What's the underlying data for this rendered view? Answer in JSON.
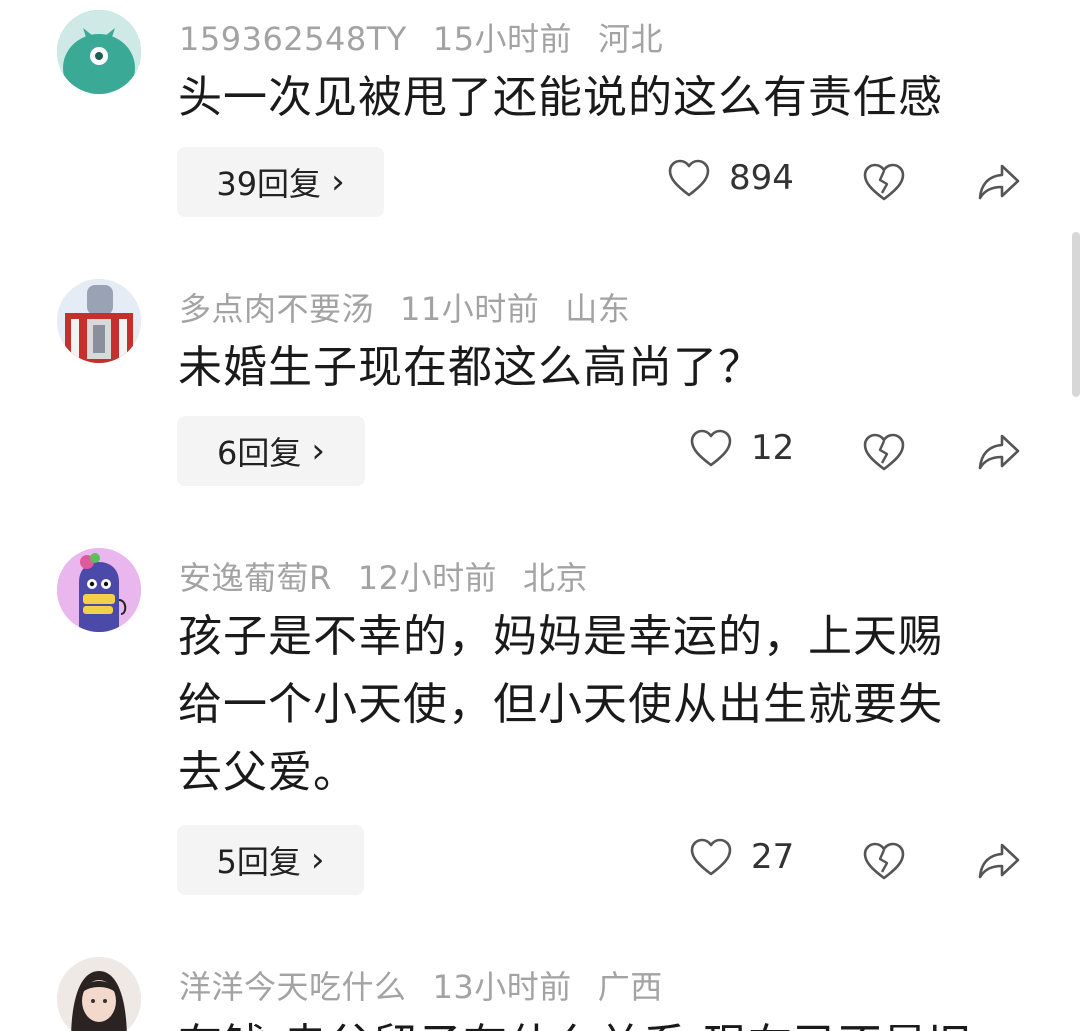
{
  "comments": [
    {
      "username": "159362548TY",
      "time": "15小时前",
      "location": "河北",
      "text_lines": [
        "头一次见被甩了还能说的这么有责任感"
      ],
      "reply_label": "39回复",
      "likes": "894",
      "avatar_icon": "teal-monster-avatar"
    },
    {
      "username": "多点肉不要汤",
      "time": "11小时前",
      "location": "山东",
      "text_lines": [
        "未婚生子现在都这么高尚了？"
      ],
      "reply_label": "6回复",
      "likes": "12",
      "avatar_icon": "photo-avatar"
    },
    {
      "username": "安逸葡萄R",
      "time": "12小时前",
      "location": "北京",
      "text_lines": [
        "孩子是不幸的，妈妈是幸运的，上天赐",
        "给一个小天使，但小天使从出生就要失",
        "去父爱。"
      ],
      "reply_label": "5回复",
      "likes": "27",
      "avatar_icon": "purple-cartoon-avatar"
    },
    {
      "username": "洋洋今天吃什么",
      "time": "13小时前",
      "location": "广西",
      "text_lines": [
        "有钱 走父留子有什么关系 现在已不是旧"
      ],
      "avatar_icon": "girl-photo-avatar"
    }
  ],
  "reply_chevron": "›",
  "colors": {
    "meta_text": "#a3a3a3",
    "body_text": "#1a1a1a",
    "reply_bg": "#f4f4f4"
  }
}
